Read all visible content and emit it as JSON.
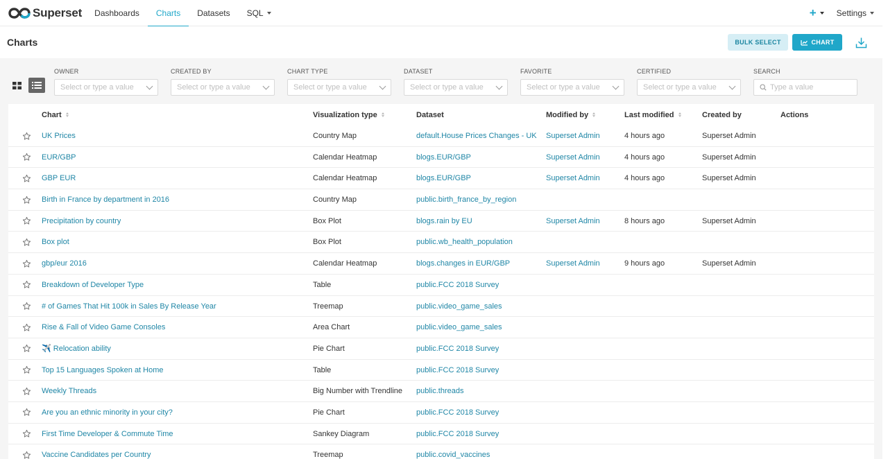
{
  "app": {
    "name": "Superset"
  },
  "nav": {
    "items": [
      {
        "label": "Dashboards",
        "active": false
      },
      {
        "label": "Charts",
        "active": true
      },
      {
        "label": "Datasets",
        "active": false
      },
      {
        "label": "SQL",
        "active": false,
        "dropdown": true
      }
    ],
    "plus_label": "+",
    "settings_label": "Settings"
  },
  "header": {
    "title": "Charts",
    "bulk_select_label": "BULK SELECT",
    "chart_button_label": "CHART"
  },
  "filters": {
    "owner": {
      "label": "OWNER",
      "placeholder": "Select or type a value"
    },
    "created_by": {
      "label": "CREATED BY",
      "placeholder": "Select or type a value"
    },
    "chart_type": {
      "label": "CHART TYPE",
      "placeholder": "Select or type a value"
    },
    "dataset": {
      "label": "DATASET",
      "placeholder": "Select or type a value"
    },
    "favorite": {
      "label": "FAVORITE",
      "placeholder": "Select or type a value"
    },
    "certified": {
      "label": "CERTIFIED",
      "placeholder": "Select or type a value"
    },
    "search": {
      "label": "SEARCH",
      "placeholder": "Type a value"
    }
  },
  "table": {
    "columns": {
      "chart": "Chart",
      "viz_type": "Visualization type",
      "dataset": "Dataset",
      "modified_by": "Modified by",
      "last_modified": "Last modified",
      "created_by": "Created by",
      "actions": "Actions"
    },
    "rows": [
      {
        "chart": "UK Prices",
        "viz_type": "Country Map",
        "dataset": "default.House Prices Changes - UK",
        "modified_by": "Superset Admin",
        "last_modified": "4 hours ago",
        "created_by": "Superset Admin"
      },
      {
        "chart": "EUR/GBP",
        "viz_type": "Calendar Heatmap",
        "dataset": "blogs.EUR/GBP",
        "modified_by": "Superset Admin",
        "last_modified": "4 hours ago",
        "created_by": "Superset Admin"
      },
      {
        "chart": "GBP EUR",
        "viz_type": "Calendar Heatmap",
        "dataset": "blogs.EUR/GBP",
        "modified_by": "Superset Admin",
        "last_modified": "4 hours ago",
        "created_by": "Superset Admin"
      },
      {
        "chart": "Birth in France by department in 2016",
        "viz_type": "Country Map",
        "dataset": "public.birth_france_by_region",
        "modified_by": "",
        "last_modified": "",
        "created_by": ""
      },
      {
        "chart": "Precipitation by country",
        "viz_type": "Box Plot",
        "dataset": "blogs.rain by EU",
        "modified_by": "Superset Admin",
        "last_modified": "8 hours ago",
        "created_by": "Superset Admin"
      },
      {
        "chart": "Box plot",
        "viz_type": "Box Plot",
        "dataset": "public.wb_health_population",
        "modified_by": "",
        "last_modified": "",
        "created_by": ""
      },
      {
        "chart": "gbp/eur 2016",
        "viz_type": "Calendar Heatmap",
        "dataset": "blogs.changes in EUR/GBP",
        "modified_by": "Superset Admin",
        "last_modified": "9 hours ago",
        "created_by": "Superset Admin"
      },
      {
        "chart": "Breakdown of Developer Type",
        "viz_type": "Table",
        "dataset": "public.FCC 2018 Survey",
        "modified_by": "",
        "last_modified": "",
        "created_by": ""
      },
      {
        "chart": "# of Games That Hit 100k in Sales By Release Year",
        "viz_type": "Treemap",
        "dataset": "public.video_game_sales",
        "modified_by": "",
        "last_modified": "",
        "created_by": ""
      },
      {
        "chart": "Rise & Fall of Video Game Consoles",
        "viz_type": "Area Chart",
        "dataset": "public.video_game_sales",
        "modified_by": "",
        "last_modified": "",
        "created_by": ""
      },
      {
        "chart": "✈️ Relocation ability",
        "viz_type": "Pie Chart",
        "dataset": "public.FCC 2018 Survey",
        "modified_by": "",
        "last_modified": "",
        "created_by": ""
      },
      {
        "chart": "Top 15 Languages Spoken at Home",
        "viz_type": "Table",
        "dataset": "public.FCC 2018 Survey",
        "modified_by": "",
        "last_modified": "",
        "created_by": ""
      },
      {
        "chart": "Weekly Threads",
        "viz_type": "Big Number with Trendline",
        "dataset": "public.threads",
        "modified_by": "",
        "last_modified": "",
        "created_by": ""
      },
      {
        "chart": "Are you an ethnic minority in your city?",
        "viz_type": "Pie Chart",
        "dataset": "public.FCC 2018 Survey",
        "modified_by": "",
        "last_modified": "",
        "created_by": ""
      },
      {
        "chart": "First Time Developer & Commute Time",
        "viz_type": "Sankey Diagram",
        "dataset": "public.FCC 2018 Survey",
        "modified_by": "",
        "last_modified": "",
        "created_by": ""
      },
      {
        "chart": "Vaccine Candidates per Country",
        "viz_type": "Treemap",
        "dataset": "public.covid_vaccines",
        "modified_by": "",
        "last_modified": "",
        "created_by": ""
      }
    ]
  },
  "icons": {
    "logo": "superset-logo-icon",
    "plus": "plus-icon",
    "chart_btn": "chart-icon",
    "import": "import-icon",
    "card_view": "grid-view-icon",
    "list_view": "list-view-icon",
    "search": "search-icon",
    "star": "star-icon"
  },
  "colors": {
    "accent": "#20a7c9",
    "link": "#1f86a6",
    "bulk_bg": "#d6eef5"
  }
}
